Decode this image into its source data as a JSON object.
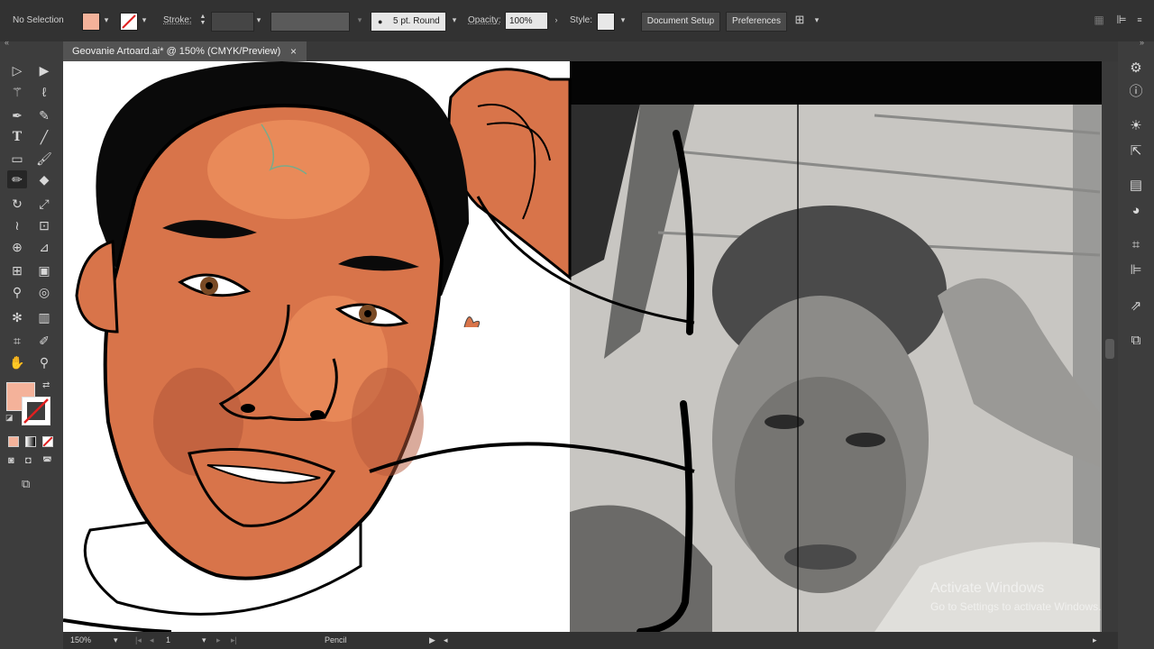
{
  "controlbar": {
    "selection_label": "No Selection",
    "stroke_label": "Stroke:",
    "brush_label": "5 pt. Round",
    "opacity_label": "Opacity:",
    "opacity_value": "100%",
    "style_label": "Style:",
    "document_setup": "Document Setup",
    "preferences": "Preferences",
    "fill_color": "#f4b29a"
  },
  "document_tab": {
    "title": "Geovanie Artoard.ai* @ 150% (CMYK/Preview)",
    "close_symbol": "×"
  },
  "statusbar": {
    "zoom": "150%",
    "artboard": "1",
    "tool": "Pencil"
  },
  "watermark": {
    "line1": "Activate Windows",
    "line2": "Go to Settings to activate Windows."
  },
  "toolbar": {
    "tools": [
      "selection-tool",
      "direct-selection-tool",
      "magic-wand-tool",
      "lasso-tool",
      "pen-tool",
      "curvature-tool",
      "type-tool",
      "line-tool",
      "rectangle-tool",
      "paintbrush-tool",
      "pencil-tool",
      "eraser-tool",
      "rotate-tool",
      "scale-tool",
      "width-tool",
      "free-transform-tool",
      "shape-builder-tool",
      "perspective-grid-tool",
      "mesh-tool",
      "gradient-tool",
      "eyedropper-tool",
      "blend-tool",
      "symbol-sprayer-tool",
      "column-graph-tool",
      "artboard-tool",
      "slice-tool",
      "hand-tool",
      "zoom-tool"
    ]
  },
  "rightdock": {
    "panels": [
      "properties-icon",
      "info-icon",
      "appearance-icon",
      "export-icon",
      "transparency-icon",
      "color-icon",
      "align-icon",
      "transform-icon",
      "links-icon",
      "layers-icon"
    ]
  },
  "colors": {
    "skin_base": "#d8744a",
    "skin_light": "#ec8e5c",
    "skin_shadow": "#b5583a",
    "ui_dark": "#323232"
  }
}
